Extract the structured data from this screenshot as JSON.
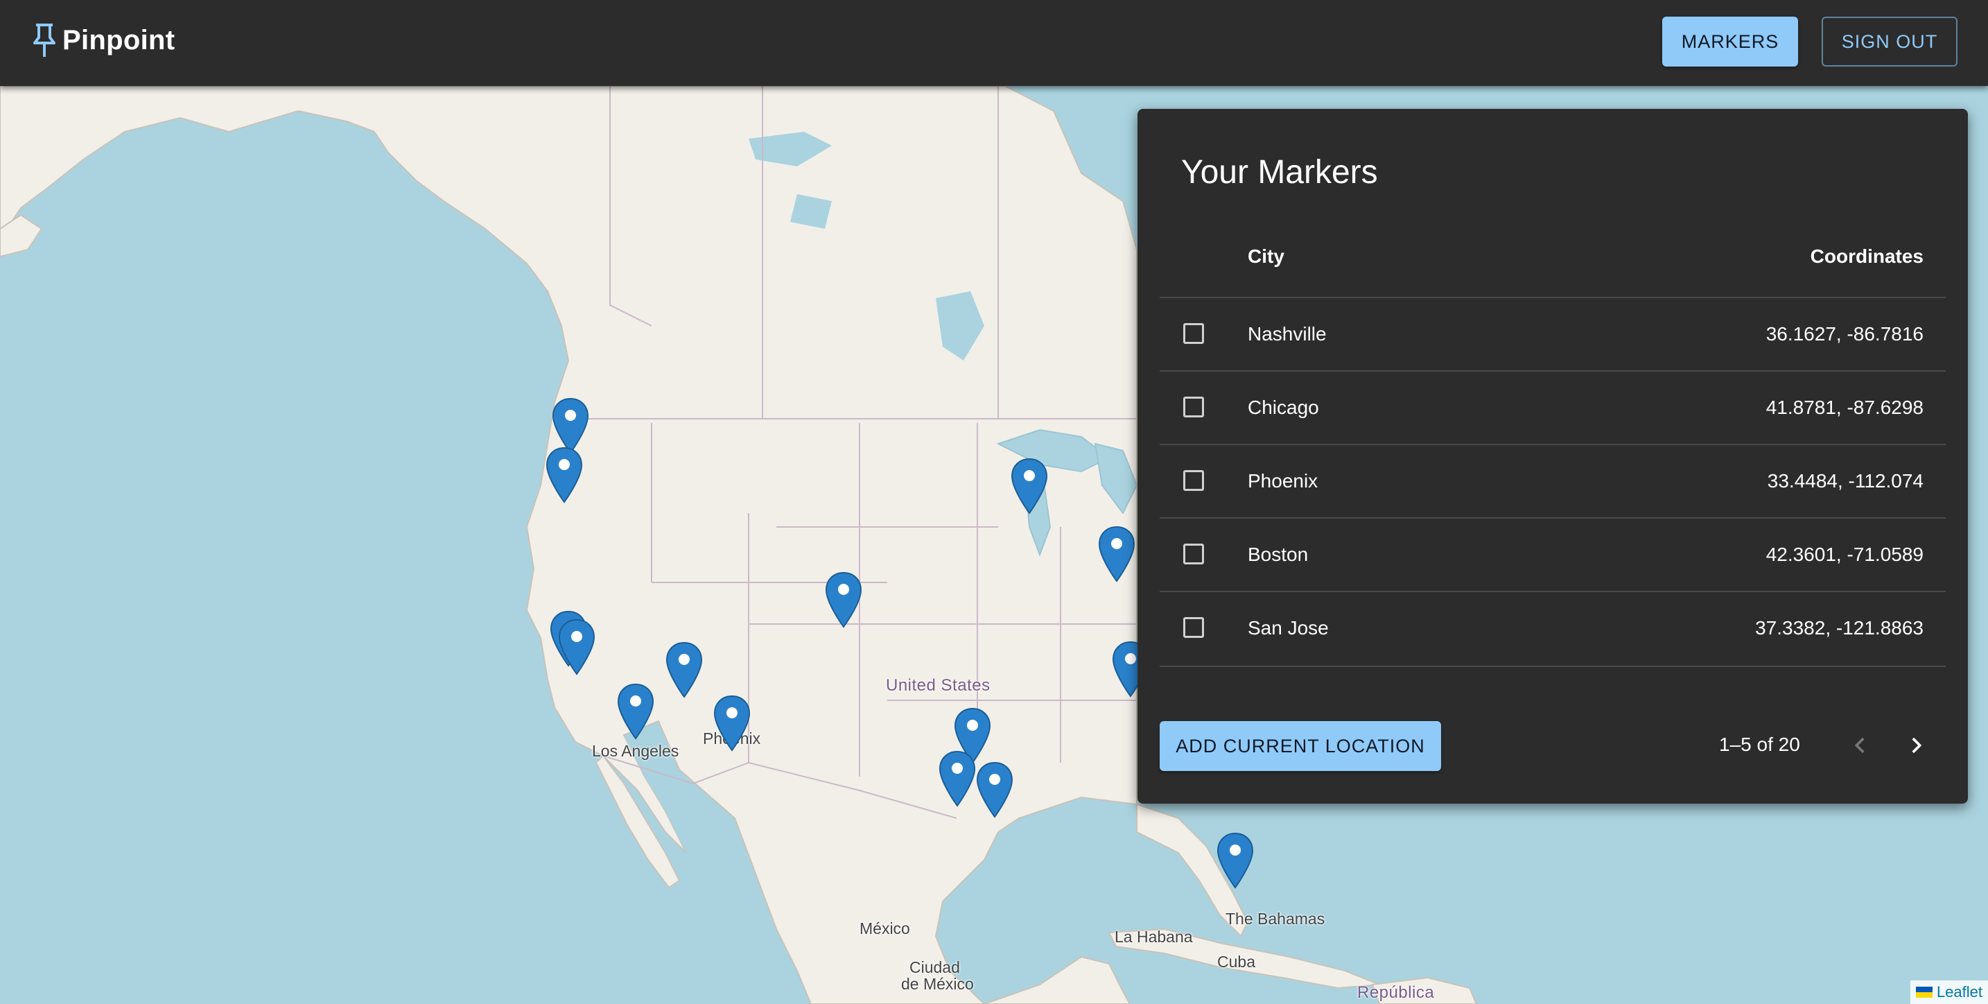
{
  "app": {
    "name": "Pinpoint",
    "logo_icon": "push-pin-icon"
  },
  "header": {
    "markers_label": "MARKERS",
    "signout_label": "SIGN OUT"
  },
  "panel": {
    "title": "Your Markers",
    "columns": {
      "city": "City",
      "coordinates": "Coordinates"
    },
    "rows": [
      {
        "city": "Nashville",
        "coordinates": "36.1627, -86.7816",
        "checked": false
      },
      {
        "city": "Chicago",
        "coordinates": "41.8781, -87.6298",
        "checked": false
      },
      {
        "city": "Phoenix",
        "coordinates": "33.4484, -112.074",
        "checked": false
      },
      {
        "city": "Boston",
        "coordinates": "42.3601, -71.0589",
        "checked": false
      },
      {
        "city": "San Jose",
        "coordinates": "37.3382, -121.8863",
        "checked": false
      }
    ],
    "add_label": "ADD CURRENT LOCATION",
    "pagination": "1–5 of 20"
  },
  "map": {
    "labels": {
      "united_states": "United States",
      "los_angeles": "Los Angeles",
      "phoenix": "Phoenix",
      "mexico": "México",
      "ciudad_de_mexico_1": "Ciudad",
      "ciudad_de_mexico_2": "de México",
      "la_habana": "La Habana",
      "cuba": "Cuba",
      "bahamas": "The Bahamas",
      "republica": "República"
    },
    "attribution": "Leaflet"
  },
  "colors": {
    "accent": "#90caf9",
    "appbar": "#2c2c2c",
    "panel": "#2c2c2c",
    "water": "#aad3df",
    "land": "#f2efe9",
    "marker": "#2a81cb"
  }
}
